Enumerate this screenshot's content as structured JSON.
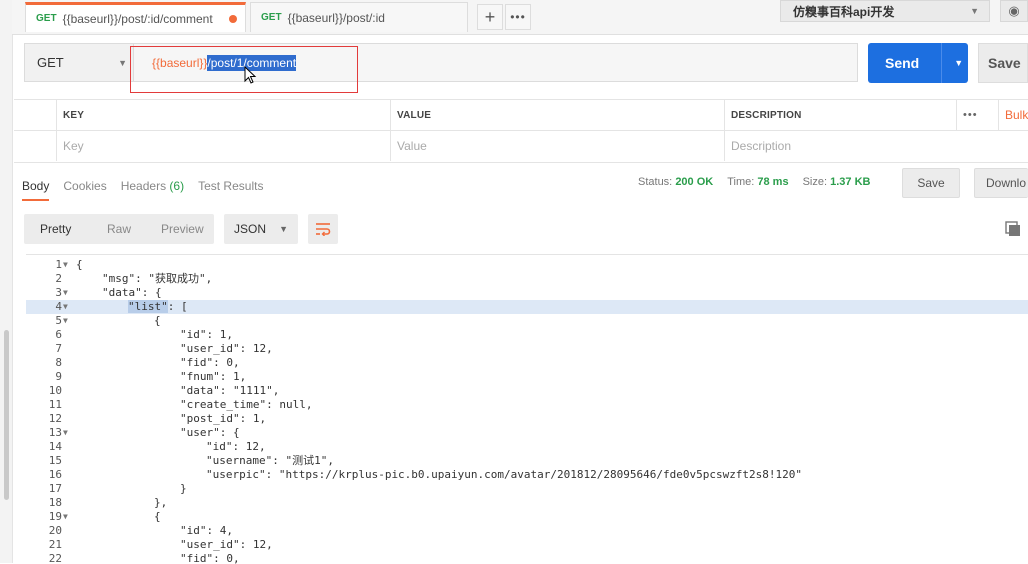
{
  "tabs": [
    {
      "method": "GET",
      "url": "{{baseurl}}/post/:id/comment",
      "active": true,
      "unsaved": true
    },
    {
      "method": "GET",
      "url": "{{baseurl}}/post/:id",
      "active": false,
      "unsaved": false
    }
  ],
  "environment": {
    "name": "仿糗事百科api开发"
  },
  "request": {
    "method": "GET",
    "url_var": "{{baseurl}}",
    "url_path": "/post/1/comment",
    "send_label": "Send",
    "save_label": "Save"
  },
  "params": {
    "headers": {
      "key": "KEY",
      "value": "VALUE",
      "description": "DESCRIPTION",
      "bulk": "Bulk"
    },
    "placeholders": {
      "key": "Key",
      "value": "Value",
      "description": "Description"
    }
  },
  "response_tabs": {
    "body": "Body",
    "cookies": "Cookies",
    "headers": "Headers",
    "headers_count": "(6)",
    "test_results": "Test Results"
  },
  "status": {
    "status_label": "Status:",
    "status_value": "200 OK",
    "time_label": "Time:",
    "time_value": "78 ms",
    "size_label": "Size:",
    "size_value": "1.37 KB",
    "save_label": "Save",
    "download_label": "Downlo"
  },
  "view": {
    "pretty": "Pretty",
    "raw": "Raw",
    "preview": "Preview",
    "format": "JSON"
  },
  "colors": {
    "accent": "#f26b3a",
    "send": "#1d6fe0",
    "success": "#2a9d4b"
  },
  "code_lines": [
    {
      "n": "1",
      "fold": true,
      "indent": 0,
      "text": "{"
    },
    {
      "n": "2",
      "fold": false,
      "indent": 1,
      "key": "\"msg\"",
      "text": ": \"获取成功\","
    },
    {
      "n": "3",
      "fold": true,
      "indent": 1,
      "key": "\"data\"",
      "text": ": {"
    },
    {
      "n": "4",
      "fold": true,
      "indent": 2,
      "key": "\"list\"",
      "text": ": [",
      "highlight": true
    },
    {
      "n": "5",
      "fold": true,
      "indent": 3,
      "text": "{"
    },
    {
      "n": "6",
      "fold": false,
      "indent": 4,
      "key": "\"id\"",
      "text": ": 1,"
    },
    {
      "n": "7",
      "fold": false,
      "indent": 4,
      "key": "\"user_id\"",
      "text": ": 12,"
    },
    {
      "n": "8",
      "fold": false,
      "indent": 4,
      "key": "\"fid\"",
      "text": ": 0,"
    },
    {
      "n": "9",
      "fold": false,
      "indent": 4,
      "key": "\"fnum\"",
      "text": ": 1,"
    },
    {
      "n": "10",
      "fold": false,
      "indent": 4,
      "key": "\"data\"",
      "text": ": \"1111\","
    },
    {
      "n": "11",
      "fold": false,
      "indent": 4,
      "key": "\"create_time\"",
      "text": ": null,"
    },
    {
      "n": "12",
      "fold": false,
      "indent": 4,
      "key": "\"post_id\"",
      "text": ": 1,"
    },
    {
      "n": "13",
      "fold": true,
      "indent": 4,
      "key": "\"user\"",
      "text": ": {"
    },
    {
      "n": "14",
      "fold": false,
      "indent": 5,
      "key": "\"id\"",
      "text": ": 12,"
    },
    {
      "n": "15",
      "fold": false,
      "indent": 5,
      "key": "\"username\"",
      "text": ": \"测试1\","
    },
    {
      "n": "16",
      "fold": false,
      "indent": 5,
      "key": "\"userpic\"",
      "text": ": \"https://krplus-pic.b0.upaiyun.com/avatar/201812/28095646/fde0v5pcswzft2s8!120\""
    },
    {
      "n": "17",
      "fold": false,
      "indent": 4,
      "text": "}"
    },
    {
      "n": "18",
      "fold": false,
      "indent": 3,
      "text": "},"
    },
    {
      "n": "19",
      "fold": true,
      "indent": 3,
      "text": "{"
    },
    {
      "n": "20",
      "fold": false,
      "indent": 4,
      "key": "\"id\"",
      "text": ": 4,"
    },
    {
      "n": "21",
      "fold": false,
      "indent": 4,
      "key": "\"user_id\"",
      "text": ": 12,"
    },
    {
      "n": "22",
      "fold": false,
      "indent": 4,
      "key": "\"fid\"",
      "text": ": 0,"
    }
  ]
}
